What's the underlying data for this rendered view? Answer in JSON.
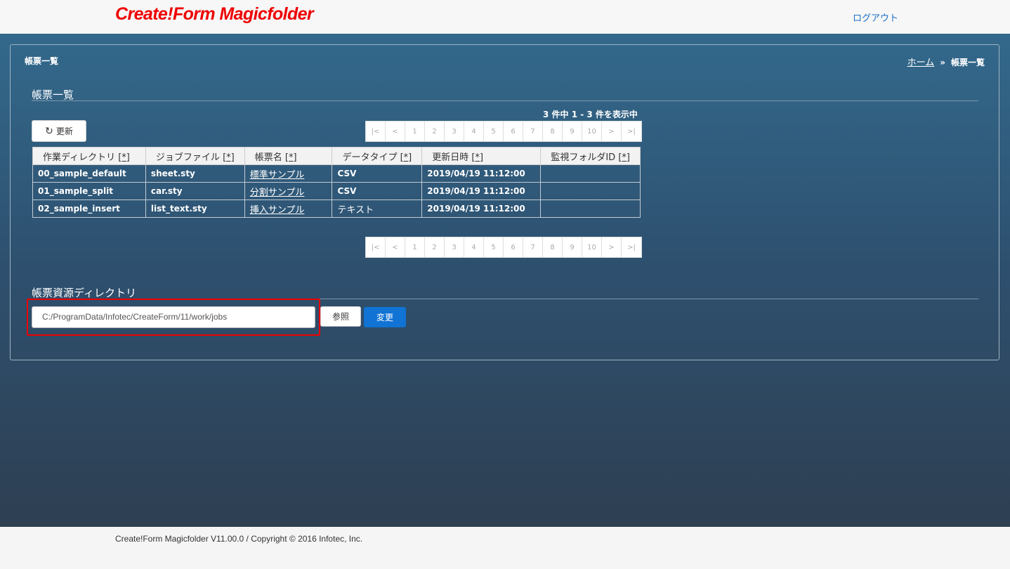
{
  "header": {
    "logo": "Create!Form Magicfolder",
    "logout": "ログアウト"
  },
  "panel": {
    "title": "帳票一覧",
    "breadcrumb": {
      "home": "ホーム",
      "separator": "»",
      "current": "帳票一覧"
    }
  },
  "forms_section": {
    "title": "帳票一覧",
    "count_text": "3 件中 1 - 3 件を表示中",
    "refresh_label": "更新",
    "pager": [
      "|<",
      "<",
      "1",
      "2",
      "3",
      "4",
      "5",
      "6",
      "7",
      "8",
      "9",
      "10",
      ">",
      ">|"
    ],
    "sort_marker": "[*]",
    "columns": [
      "作業ディレクトリ",
      "ジョブファイル",
      "帳票名",
      "データタイプ",
      "更新日時",
      "監視フォルダID"
    ],
    "rows": [
      {
        "dir": "00_sample_default",
        "job": "sheet.sty",
        "name": "標準サンプル",
        "type": "CSV",
        "updated": "2019/04/19 11:12:00",
        "watch_id": ""
      },
      {
        "dir": "01_sample_split",
        "job": "car.sty",
        "name": "分割サンプル",
        "type": "CSV",
        "updated": "2019/04/19 11:12:00",
        "watch_id": ""
      },
      {
        "dir": "02_sample_insert",
        "job": "list_text.sty",
        "name": "挿入サンプル",
        "type": "テキスト",
        "updated": "2019/04/19 11:12:00",
        "watch_id": ""
      }
    ]
  },
  "resource_section": {
    "title": "帳票資源ディレクトリ",
    "path_value": "C:/ProgramData/Infotec/CreateForm/11/work/jobs",
    "browse_label": "参照",
    "change_label": "変更"
  },
  "footer": {
    "text": "Create!Form Magicfolder V11.00.0 / Copyright © 2016 Infotec, Inc."
  },
  "colors": {
    "brand": "#ee0000",
    "link": "#1a6fc4",
    "primary_button": "#1173d4",
    "background_top": "#33698c",
    "background_bottom": "#2e3f52",
    "highlight": "#ee0000"
  }
}
